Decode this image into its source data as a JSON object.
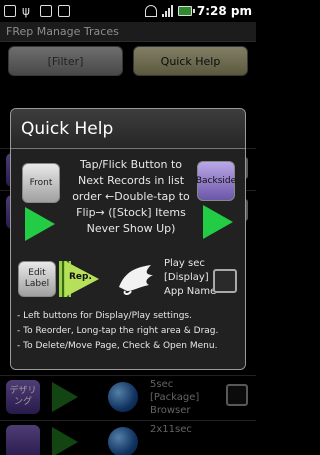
{
  "status_bar": {
    "time": "7:28 pm",
    "left_icons": [
      "alert-icon",
      "usb-icon",
      "sd-icon",
      "photo-icon"
    ],
    "right_icons": [
      "wifi-icon",
      "signal-icon",
      "battery-icon"
    ]
  },
  "app": {
    "title": "FRep Manage Traces",
    "filter_label": "[Filter]",
    "quick_help_label": "Quick Help"
  },
  "background_list": [
    {
      "chip": "",
      "text": ""
    },
    {
      "chip": "デザリ\nング",
      "line1": "5sec",
      "line2": "[Package]",
      "line3": "Browser"
    },
    {
      "chip": "",
      "line1": "2x11sec"
    }
  ],
  "dialog": {
    "title": "Quick Help",
    "front_label": "Front",
    "backside_label": "Backside",
    "help_text": "Tap/Flick Button to Next Records in list order ←Double-tap to Flip→ ([Stock] Items Never Show Up)",
    "edit_label": "Edit Label",
    "rep_label": "Rep.",
    "play_sec": "Play sec",
    "display": "[Display]",
    "app_name": "App Name",
    "notes": [
      "- Left buttons for Display/Play settings.",
      "- To Reorder, Long-tap the right area & Drag.",
      "- To Delete/Move Page, Check & Open Menu."
    ]
  },
  "colors": {
    "play_green": "#22cc44",
    "rep_green": "#b7e05a",
    "backside_purple": "#8f7bd0",
    "quick_help_button": "#a9a57c"
  }
}
